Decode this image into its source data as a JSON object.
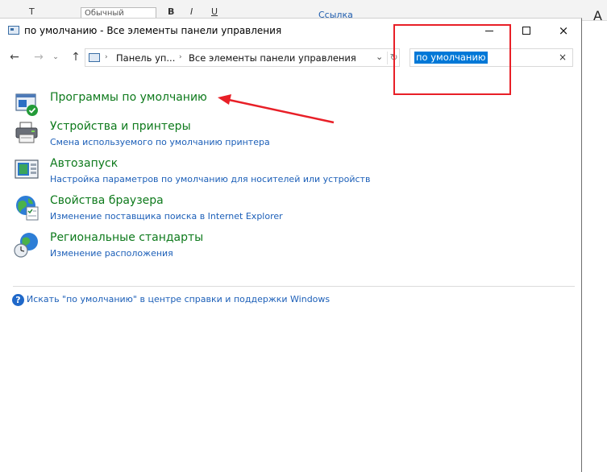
{
  "background_toolbar": {
    "font_letter": "Т",
    "style_value": "Обычный",
    "bold": "B",
    "italic": "I",
    "underline": "U",
    "link": "Ссылка",
    "right_glyph": "А"
  },
  "window": {
    "title": "по умолчанию - Все элементы панели управления",
    "icons": {
      "title": "control-panel-icon",
      "minimize": "minimize-icon",
      "maximize": "maximize-icon",
      "close": "close-icon"
    }
  },
  "nav": {
    "back_glyph": "←",
    "forward_glyph": "→",
    "dropdown_glyph": "⌄",
    "up_glyph": "↑",
    "breadcrumb": [
      "Панель уп...",
      "Все элементы панели управления"
    ],
    "breadcrumb_separator": "›",
    "refresh_glyph": "↻",
    "address_dropdown_glyph": "⌄"
  },
  "search": {
    "value": "по умолчанию",
    "clear_glyph": "×"
  },
  "items": [
    {
      "title": "Программы по умолчанию",
      "subtitle": "",
      "icon": "default-programs-icon"
    },
    {
      "title": "Устройства и принтеры",
      "subtitle": "Смена используемого по умолчанию принтера",
      "icon": "printer-icon"
    },
    {
      "title": "Автозапуск",
      "subtitle": "Настройка параметров по умолчанию для носителей или устройств",
      "icon": "autoplay-icon"
    },
    {
      "title": "Свойства браузера",
      "subtitle": "Изменение поставщика поиска в Internet Explorer",
      "icon": "internet-options-icon"
    },
    {
      "title": "Региональные стандарты",
      "subtitle": "Изменение расположения",
      "icon": "region-globe-icon"
    }
  ],
  "help": {
    "text": "Искать \"по умолчанию\" в центре справки и поддержки Windows",
    "glyph": "?"
  },
  "annotation_color": "#e81f27",
  "accent_green": "#0e7a1c",
  "link_blue": "#1c5fb8"
}
